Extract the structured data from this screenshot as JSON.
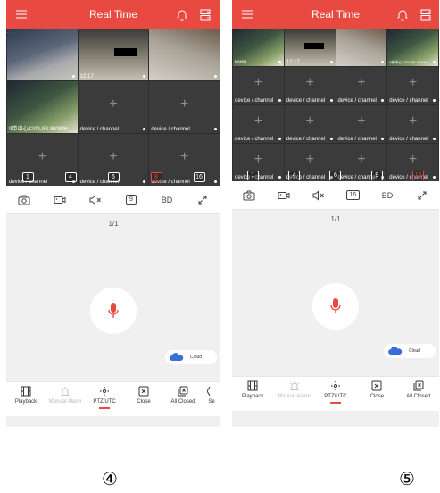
{
  "screens": [
    {
      "id": "4",
      "title": "Real Time",
      "cells": [
        {
          "label": "",
          "live": true
        },
        {
          "label": "12:17",
          "live": true
        },
        {
          "label": "",
          "live": true
        },
        {
          "label": "9带中心4200-IBL800WH",
          "live": true
        },
        {
          "label": "device / channel",
          "live": false
        },
        {
          "label": "device / channel",
          "live": false
        },
        {
          "label": "device / channel",
          "live": false
        },
        {
          "label": "device / channel",
          "live": false
        },
        {
          "label": "device / channel",
          "live": false
        }
      ],
      "layouts": [
        "1",
        "4",
        "6",
        "9",
        "16"
      ],
      "active_layout": "9",
      "toolbar": {
        "quality": "BD",
        "layout_badge": "9"
      },
      "page": "1/1",
      "cloud": "Cloud",
      "bottom": [
        {
          "label": "Playback",
          "icon": "film-icon",
          "disabled": false
        },
        {
          "label": "Manual Alarm",
          "icon": "alarm-icon",
          "disabled": true
        },
        {
          "label": "PTZ/UTC",
          "icon": "ptz-icon",
          "disabled": false,
          "active": true
        },
        {
          "label": "Close",
          "icon": "close-box-icon",
          "disabled": false
        },
        {
          "label": "All Closed",
          "icon": "all-closed-icon",
          "disabled": false
        },
        {
          "label": "Se",
          "icon": "more-icon",
          "disabled": false
        }
      ],
      "marker": "④"
    },
    {
      "id": "5",
      "title": "Real Time",
      "cells": [
        {
          "label": "www",
          "live": true
        },
        {
          "label": "12:17",
          "live": true
        },
        {
          "label": "",
          "live": true
        },
        {
          "label": "9带中心4200-IBL800WH",
          "live": true
        },
        {
          "label": "device / channel",
          "live": false
        },
        {
          "label": "device / channel",
          "live": false
        },
        {
          "label": "device / channel",
          "live": false
        },
        {
          "label": "device / channel",
          "live": false
        },
        {
          "label": "device / channel",
          "live": false
        },
        {
          "label": "device / channel",
          "live": false
        },
        {
          "label": "device / channel",
          "live": false
        },
        {
          "label": "device / channel",
          "live": false
        },
        {
          "label": "device / channel",
          "live": false
        },
        {
          "label": "device / channel",
          "live": false
        },
        {
          "label": "device / channel",
          "live": false
        },
        {
          "label": "device / channel",
          "live": false
        }
      ],
      "layouts": [
        "1",
        "4",
        "6",
        "9",
        "16"
      ],
      "active_layout": "16",
      "toolbar": {
        "quality": "BD",
        "layout_badge": "16"
      },
      "page": "1/1",
      "cloud": "Cloud",
      "bottom": [
        {
          "label": "Playback",
          "icon": "film-icon",
          "disabled": false
        },
        {
          "label": "Manual Alarm",
          "icon": "alarm-icon",
          "disabled": true
        },
        {
          "label": "PTZ/UTC",
          "icon": "ptz-icon",
          "disabled": false,
          "active": true
        },
        {
          "label": "Close",
          "icon": "close-box-icon",
          "disabled": false
        },
        {
          "label": "All Closed",
          "icon": "all-closed-icon",
          "disabled": false
        }
      ],
      "marker": "⑤"
    }
  ],
  "colors": {
    "accent": "#e84a41",
    "mic": "#e84a41",
    "cloud": "#3b6fd8"
  }
}
